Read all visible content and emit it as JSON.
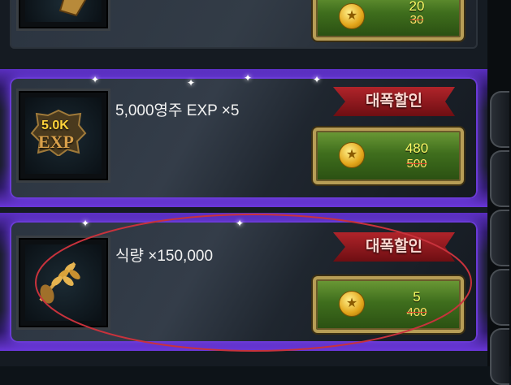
{
  "items": [
    {
      "title": "",
      "ribbon": "",
      "price_new": "20",
      "price_old": "30",
      "icon": "treasure-icon"
    },
    {
      "title": "5,000영주 EXP ×5",
      "ribbon": "대폭할인",
      "price_new": "480",
      "price_old": "500",
      "icon": "exp-icon",
      "icon_text_top": "5.0K",
      "icon_text_bottom": "EXP"
    },
    {
      "title": "식량 ×150,000",
      "ribbon": "대폭할인",
      "price_new": "5",
      "price_old": "400",
      "icon": "wheat-icon"
    }
  ],
  "coin_icon": "gold-coin-icon",
  "colors": {
    "glow": "#7b44ff",
    "ribbon": "#b0242a",
    "button": "#3f6e1d",
    "annotation": "#c8323c"
  }
}
